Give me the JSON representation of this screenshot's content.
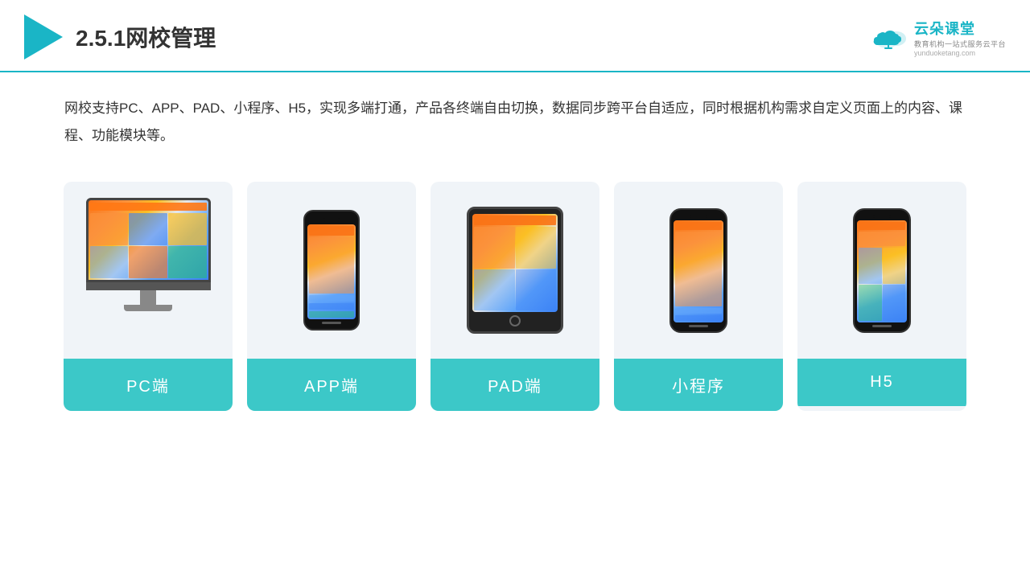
{
  "header": {
    "title": "2.5.1网校管理",
    "brand": {
      "name": "云朵课堂",
      "url": "yunduoketang.com",
      "sub": "教育机构一站式服务云平台"
    }
  },
  "description": "网校支持PC、APP、PAD、小程序、H5，实现多端打通，产品各终端自由切换，数据同步跨平台自适应，同时根据机构需求自定义页面上的内容、课程、功能模块等。",
  "cards": [
    {
      "id": "pc",
      "label": "PC端"
    },
    {
      "id": "app",
      "label": "APP端"
    },
    {
      "id": "pad",
      "label": "PAD端"
    },
    {
      "id": "miniprogram",
      "label": "小程序"
    },
    {
      "id": "h5",
      "label": "H5"
    }
  ],
  "colors": {
    "accent": "#1ab5c6",
    "card_bg": "#f0f4f8",
    "card_label_bg": "#3cc8c8"
  }
}
